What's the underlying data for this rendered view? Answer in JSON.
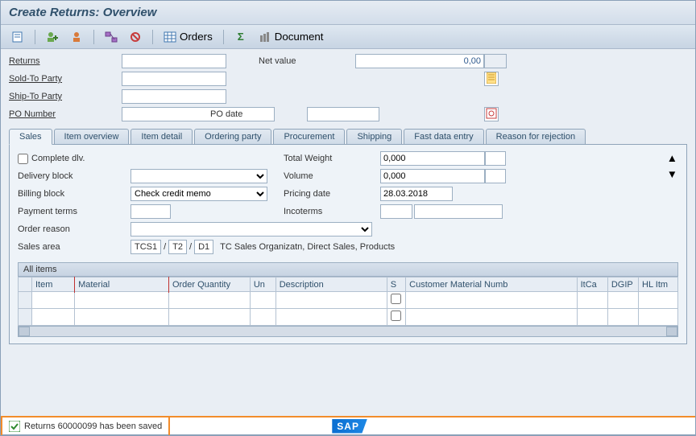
{
  "title": "Create Returns: Overview",
  "toolbar": {
    "orders_label": "Orders",
    "document_label": "Document"
  },
  "form": {
    "returns_label": "Returns",
    "returns_value": "",
    "netvalue_label": "Net value",
    "netvalue_value": "0,00",
    "currency_value": "",
    "soldto_label": "Sold-To Party",
    "soldto_value": "",
    "shipto_label": "Ship-To Party",
    "shipto_value": "",
    "po_label": "PO Number",
    "po_value": "",
    "podate_label": "PO date",
    "podate_value": ""
  },
  "tabs": [
    "Sales",
    "Item overview",
    "Item detail",
    "Ordering party",
    "Procurement",
    "Shipping",
    "Fast data entry",
    "Reason for rejection"
  ],
  "sales": {
    "complete_label": "Complete dlv.",
    "totalweight_label": "Total Weight",
    "totalweight_value": "0,000",
    "weight_unit": "",
    "delivblock_label": "Delivery block",
    "delivblock_value": "",
    "volume_label": "Volume",
    "volume_value": "0,000",
    "volume_unit": "",
    "billblock_label": "Billing block",
    "billblock_value": "Check credit memo",
    "pricingdate_label": "Pricing date",
    "pricingdate_value": "28.03.2018",
    "payterms_label": "Payment terms",
    "payterms_value": "",
    "incoterms_label": "Incoterms",
    "incoterms_value": "",
    "incoterms_loc": "",
    "orderreason_label": "Order reason",
    "orderreason_value": "",
    "salesarea_label": "Sales area",
    "salesarea_org": "TCS1",
    "salesarea_ch": "T2",
    "salesarea_div": "D1",
    "salesarea_text": "TC Sales Organizatn, Direct Sales, Products"
  },
  "items": {
    "section_title": "All items",
    "cols": [
      "Item",
      "Material",
      "Order Quantity",
      "Un",
      "Description",
      "S",
      "Customer Material Numb",
      "ItCa",
      "DGIP",
      "HL Itm"
    ]
  },
  "status": {
    "message": "Returns 60000099 has been saved",
    "logo": "SAP"
  }
}
